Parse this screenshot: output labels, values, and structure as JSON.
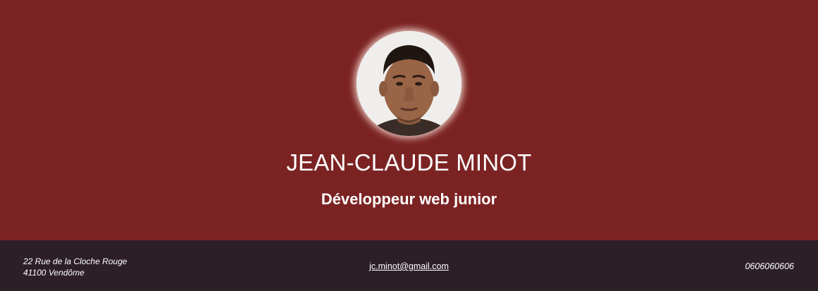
{
  "header": {
    "name": "JEAN-CLAUDE MINOT",
    "job_title": "Développeur web junior"
  },
  "footer": {
    "address_line1": "22 Rue de la Cloche Rouge",
    "address_line2": "41100 Vendôme",
    "email": "jc.minot@gmail.com",
    "phone": "0606060606"
  },
  "colors": {
    "header_background": "#7b2323",
    "footer_background": "#2c1f27",
    "text": "#ffffff"
  }
}
